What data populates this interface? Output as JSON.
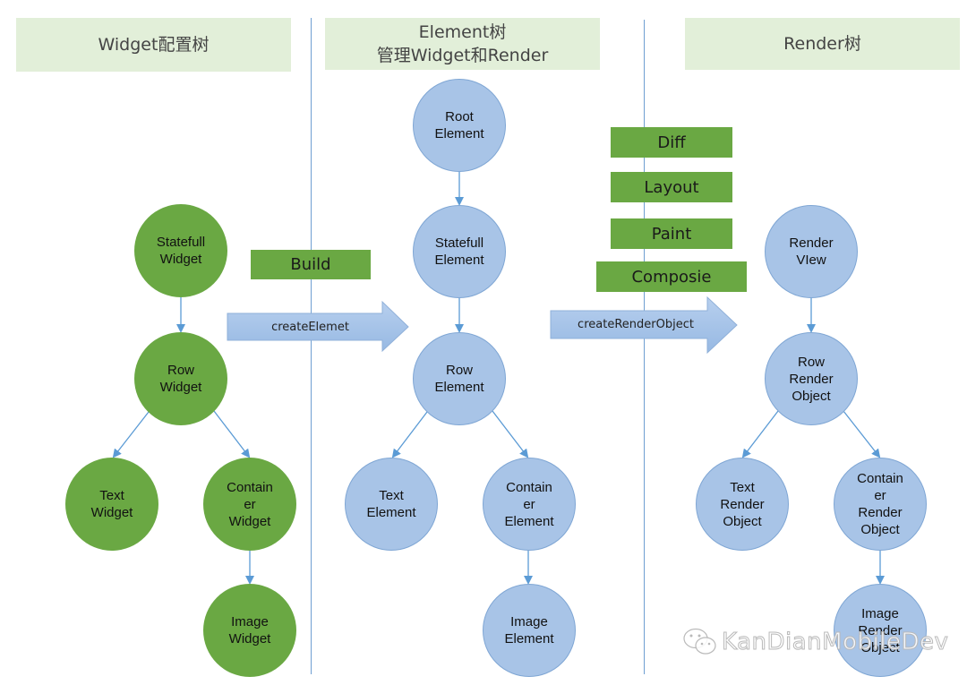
{
  "headers": {
    "widget": "Widget配置树",
    "element_line1": "Element树",
    "element_line2": "管理Widget和Render",
    "render": "Render树"
  },
  "steps": {
    "build": "Build",
    "diff": "Diff",
    "layout": "Layout",
    "paint": "Paint",
    "compose": "Composie"
  },
  "arrows": {
    "create_element": "createElemet",
    "create_render_object": "createRenderObject"
  },
  "widget_tree": {
    "statefull": [
      "Statefull",
      "Widget"
    ],
    "row": [
      "Row",
      "Widget"
    ],
    "text": [
      "Text",
      "Widget"
    ],
    "container": [
      "Contain",
      "er",
      "Widget"
    ],
    "image": [
      "Image",
      "Widget"
    ]
  },
  "element_tree": {
    "root": [
      "Root",
      "Element"
    ],
    "statefull": [
      "Statefull",
      "Element"
    ],
    "row": [
      "Row",
      "Element"
    ],
    "text": [
      "Text",
      "Element"
    ],
    "container": [
      "Contain",
      "er",
      "Element"
    ],
    "image": [
      "Image",
      "Element"
    ]
  },
  "render_tree": {
    "view": [
      "Render",
      "VIew"
    ],
    "row": [
      "Row",
      "Render",
      "Object"
    ],
    "text": [
      "Text",
      "Render",
      "Object"
    ],
    "container": [
      "Contain",
      "er",
      "Render",
      "Object"
    ],
    "image": [
      "Image",
      "Render",
      "Object"
    ]
  },
  "watermark": "KanDianMobileDev",
  "colors": {
    "header_bg": "#e2efd9",
    "widget_green": "#6aa843",
    "element_blue": "#a8c4e7",
    "connector_blue": "#5b9bd5",
    "divider_blue": "#6f9fd2"
  }
}
